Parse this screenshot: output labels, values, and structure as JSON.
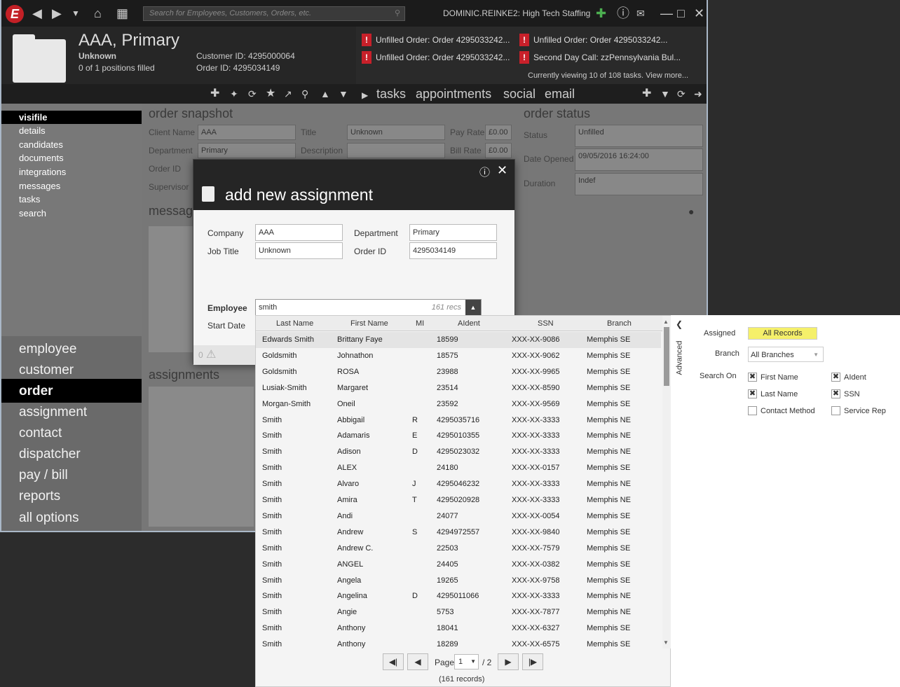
{
  "topbar": {
    "search_placeholder": "Search for Employees, Customers, Orders, etc.",
    "user": "DOMINIC.REINKE2: High Tech Staffing"
  },
  "record": {
    "title": "AAA, Primary",
    "status": "Unknown",
    "positions": "0 of 1 positions filled",
    "customer_id": "Customer ID: 4295000064",
    "order_id": "Order ID: 4295034149"
  },
  "tasks": {
    "items": [
      "Unfilled Order: Order 4295033242...",
      "Unfilled Order: Order 4295033242...",
      "Unfilled Order: Order 4295033242...",
      "Second Day Call: zzPennsylvania Bul..."
    ],
    "summary": "Currently viewing 10 of 108 tasks. View more..."
  },
  "tabs": [
    "tasks",
    "appointments",
    "social",
    "email"
  ],
  "sidebar": {
    "items": [
      "visifile",
      "details",
      "candidates",
      "documents",
      "integrations",
      "messages",
      "tasks",
      "search"
    ],
    "big": [
      "employee",
      "customer",
      "order",
      "assignment",
      "contact",
      "dispatcher",
      "pay / bill",
      "reports",
      "all options"
    ]
  },
  "snapshot": {
    "title": "order snapshot",
    "client_name_label": "Client Name",
    "client_name": "AAA",
    "title_label": "Title",
    "title_val": "Unknown",
    "pay_rate_label": "Pay Rate",
    "pay_rate": "£0.00",
    "department_label": "Department",
    "department": "Primary",
    "description_label": "Description",
    "bill_rate_label": "Bill Rate",
    "bill_rate": "£0.00",
    "order_id_label": "Order ID",
    "supervisor_label": "Supervisor",
    "messages": "message",
    "assignments": "assignments"
  },
  "status": {
    "title": "order status",
    "status_label": "Status",
    "status": "Unfilled",
    "date_label": "Date Opened",
    "date": "09/05/2016 16:24:00",
    "duration_label": "Duration",
    "duration": "Indef"
  },
  "dialog": {
    "title": "add new assignment",
    "company_label": "Company",
    "company": "AAA",
    "department_label": "Department",
    "department": "Primary",
    "job_title_label": "Job Title",
    "job_title": "Unknown",
    "order_id_label": "Order ID",
    "order_id": "4295034149",
    "employee_label": "Employee",
    "employee": "smith",
    "recs": "161 recs",
    "start_date_label": "Start Date",
    "zero": "0"
  },
  "grid": {
    "headers": [
      "Last Name",
      "First Name",
      "MI",
      "AIdent",
      "SSN",
      "Branch"
    ],
    "rows": [
      [
        "Edwards Smith",
        "Brittany Faye",
        "",
        "18599",
        "XXX-XX-9086",
        "Memphis SE"
      ],
      [
        "Goldsmith",
        "Johnathon",
        "",
        "18575",
        "XXX-XX-9062",
        "Memphis SE"
      ],
      [
        "Goldsmith",
        "ROSA",
        "",
        "23988",
        "XXX-XX-9965",
        "Memphis SE"
      ],
      [
        "Lusiak-Smith",
        "Margaret",
        "",
        "23514",
        "XXX-XX-8590",
        "Memphis SE"
      ],
      [
        "Morgan-Smith",
        "Oneil",
        "",
        "23592",
        "XXX-XX-9569",
        "Memphis SE"
      ],
      [
        "Smith",
        "Abbigail",
        "R",
        "4295035716",
        "XXX-XX-3333",
        "Memphis NE"
      ],
      [
        "Smith",
        "Adamaris",
        "E",
        "4295010355",
        "XXX-XX-3333",
        "Memphis NE"
      ],
      [
        "Smith",
        "Adison",
        "D",
        "4295023032",
        "XXX-XX-3333",
        "Memphis NE"
      ],
      [
        "Smith",
        "ALEX",
        "",
        "24180",
        "XXX-XX-0157",
        "Memphis SE"
      ],
      [
        "Smith",
        "Alvaro",
        "J",
        "4295046232",
        "XXX-XX-3333",
        "Memphis NE"
      ],
      [
        "Smith",
        "Amira",
        "T",
        "4295020928",
        "XXX-XX-3333",
        "Memphis NE"
      ],
      [
        "Smith",
        "Andi",
        "",
        "24077",
        "XXX-XX-0054",
        "Memphis SE"
      ],
      [
        "Smith",
        "Andrew",
        "S",
        "4294972557",
        "XXX-XX-9840",
        "Memphis SE"
      ],
      [
        "Smith",
        "Andrew C.",
        "",
        "22503",
        "XXX-XX-7579",
        "Memphis SE"
      ],
      [
        "Smith",
        "ANGEL",
        "",
        "24405",
        "XXX-XX-0382",
        "Memphis SE"
      ],
      [
        "Smith",
        "Angela",
        "",
        "19265",
        "XXX-XX-9758",
        "Memphis SE"
      ],
      [
        "Smith",
        "Angelina",
        "D",
        "4295011066",
        "XXX-XX-3333",
        "Memphis NE"
      ],
      [
        "Smith",
        "Angie",
        "",
        "5753",
        "XXX-XX-7877",
        "Memphis NE"
      ],
      [
        "Smith",
        "Anthony",
        "",
        "18041",
        "XXX-XX-6327",
        "Memphis SE"
      ],
      [
        "Smith",
        "Anthony",
        "",
        "18289",
        "XXX-XX-6575",
        "Memphis SE"
      ]
    ],
    "page_label": "Page",
    "page": "1",
    "of": "/ 2",
    "records": "(161 records)"
  },
  "advanced": {
    "tab": "Advanced",
    "assigned_label": "Assigned",
    "assigned": "All Records",
    "branch_label": "Branch",
    "branch": "All Branches",
    "search_on_label": "Search On",
    "opts": [
      {
        "label": "First Name",
        "checked": true
      },
      {
        "label": "AIdent",
        "checked": true
      },
      {
        "label": "Last Name",
        "checked": true
      },
      {
        "label": "SSN",
        "checked": true
      },
      {
        "label": "Contact Method",
        "checked": false
      },
      {
        "label": "Service Rep",
        "checked": false
      }
    ]
  },
  "colors": {
    "accent_yellow": "#f5f06a",
    "task_red": "#c8202a"
  }
}
